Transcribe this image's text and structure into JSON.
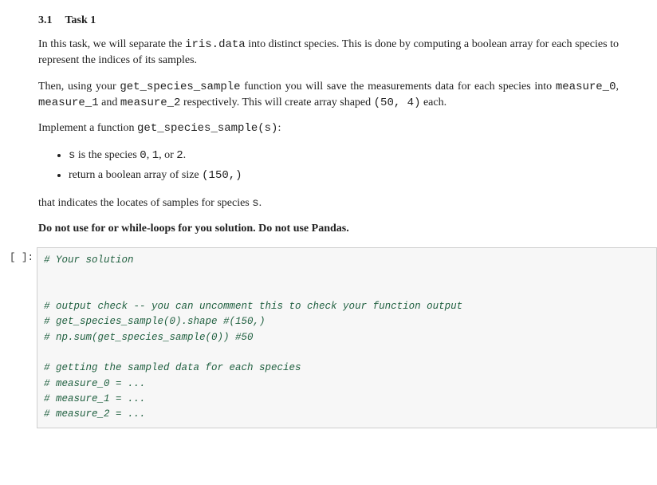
{
  "heading": {
    "number": "3.1",
    "title": "Task 1"
  },
  "para1_a": "In this task, we will separate the ",
  "para1_code": "iris.data",
  "para1_b": " into distinct species.  This is done by computing a boolean array for each species to represent the indices of its samples.",
  "para2_a": "Then, using your ",
  "para2_code1": "get_species_sample",
  "para2_b": " function you will save the measurements data for each species into ",
  "para2_code2": "measure_0",
  "para2_c": ", ",
  "para2_code3": "measure_1",
  "para2_d": " and ",
  "para2_code4": "measure_2",
  "para2_e": " respectively.  This will create array shaped ",
  "para2_code5": "(50, 4)",
  "para2_f": " each.",
  "para3_a": "Implement a function ",
  "para3_code": "get_species_sample(s)",
  "para3_b": ":",
  "bullet1_code1": "s",
  "bullet1_a": " is the species ",
  "bullet1_code2": "0",
  "bullet1_b": ", ",
  "bullet1_code3": "1",
  "bullet1_c": ", or ",
  "bullet1_code4": "2",
  "bullet1_d": ".",
  "bullet2_a": "return a boolean array of size ",
  "bullet2_code": "(150,)",
  "para4_a": "that indicates the locates of samples for species ",
  "para4_code": "s",
  "para4_b": ".",
  "para5": "Do not use for or while-loops for you solution. Do not use Pandas.",
  "prompt": "[ ]:",
  "code": "# Your solution\n\n\n# output check -- you can uncomment this to check your function output\n# get_species_sample(0).shape #(150,)\n# np.sum(get_species_sample(0)) #50\n\n# getting the sampled data for each species\n# measure_0 = ...\n# measure_1 = ...\n# measure_2 = ..."
}
